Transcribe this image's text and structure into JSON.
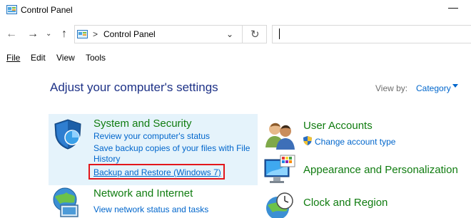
{
  "window": {
    "title": "Control Panel"
  },
  "address": {
    "path": "Control Panel",
    "separator": ">"
  },
  "menu": [
    {
      "label": "File"
    },
    {
      "label": "Edit"
    },
    {
      "label": "View"
    },
    {
      "label": "Tools"
    }
  ],
  "main": {
    "heading": "Adjust your computer's settings",
    "view_by_label": "View by:",
    "view_by_value": "Category"
  },
  "categories": {
    "system": {
      "title": "System and Security",
      "links": [
        "Review your computer's status",
        "Save backup copies of your files with File History",
        "Backup and Restore (Windows 7)"
      ]
    },
    "network": {
      "title": "Network and Internet",
      "links": [
        "View network status and tasks"
      ]
    },
    "user": {
      "title": "User Accounts",
      "links": [
        "Change account type"
      ]
    },
    "appearance": {
      "title": "Appearance and Personalization"
    },
    "clock": {
      "title": "Clock and Region"
    }
  },
  "colors": {
    "category_title": "#107c10",
    "link": "#0066cc",
    "heading": "#1e3287",
    "highlight_panel": "#e5f3fb",
    "annotation_box": "#e3161b"
  },
  "icons": [
    "control-panel-icon",
    "back-arrow-icon",
    "forward-arrow-icon",
    "recent-locations-chevron-icon",
    "up-arrow-icon",
    "refresh-icon",
    "shield-icon",
    "users-icon",
    "monitor-icon",
    "globe-network-icon",
    "clock-globe-icon",
    "uac-shield-icon"
  ]
}
